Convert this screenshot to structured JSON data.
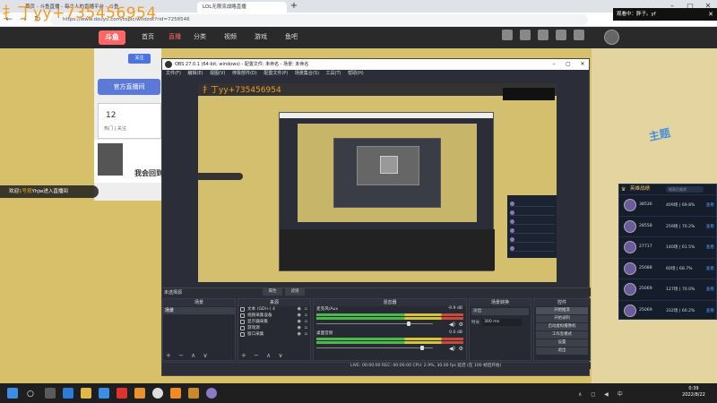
{
  "browser": {
    "tab1_title": "首页 - 斗鱼直播 - 每个人的直播平台 - 斗鱼",
    "tab2_title": "LOL无限流战略直播",
    "url": "https://www.douyu.com/topic/wndzdt?rid=7258546"
  },
  "watermark": "扌丁yy+735456954",
  "site": {
    "logo": "斗鱼",
    "nav": [
      "首页",
      "直播",
      "分类",
      "视频",
      "游戏",
      "鱼吧"
    ],
    "mini_button": "关注",
    "blue_button": "官方直播间",
    "card_num": "12",
    "card_label": "热门 | 关注",
    "streamer_name": "我会回到",
    "brand_logo": "主题"
  },
  "viewer_box": {
    "text": "观看中：胖子。yf",
    "close": "✕"
  },
  "chat_toast": {
    "prefix": "欢迎",
    "user": "1号观",
    "suffix": "Yhjw进入直播间"
  },
  "obs": {
    "title": "OBS 27.0.1 (64-bit, windows) - 配置文件: 未命名 - 场景: 未命名",
    "menus": [
      "文件(F)",
      "编辑(E)",
      "视图(V)",
      "停靠部件(D)",
      "配置文件(P)",
      "场景集合(S)",
      "工具(T)",
      "帮助(H)"
    ],
    "no_source": "未选择源",
    "properties_btn": "属性",
    "filters_btn": "滤镜",
    "docks": {
      "scenes_title": "场景",
      "sources_title": "来源",
      "mixer_title": "混音器",
      "transitions_title": "场景转换",
      "controls_title": "控件"
    },
    "scene_item": "场景",
    "sources": [
      "文本 (GDI+) 4",
      "视频采集设备",
      "显示器采集",
      "游戏源",
      "窗口采集"
    ],
    "mixer_tracks": [
      {
        "name": "麦克风/Aux",
        "db": "-9.9 dB",
        "level": 0.8
      },
      {
        "name": "桌面音频",
        "db": "0.0 dB",
        "level": 0.92
      }
    ],
    "transition_select": "淡出",
    "duration_label": "时长",
    "duration_value": "300 ms",
    "controls": [
      "开始推流",
      "开始录制",
      "启动虚拟摄像机",
      "工作室模式",
      "设置",
      "退出"
    ],
    "status": "LIVE: 00:00:00   REC: 00:00:00   CPU: 2.9%, 30.00 fps   延迟 (在 100 帧后开始)",
    "dock_foot": "+ − ∧ ∨"
  },
  "scoreboard": {
    "title": "英雄战绩",
    "search_placeholder": "搜索召唤师",
    "rows": [
      {
        "rank": "38536",
        "stat": "409场 | 69.8%",
        "link": "查看"
      },
      {
        "rank": "28558",
        "stat": "259场 | 70.2%",
        "link": "查看"
      },
      {
        "rank": "27717",
        "stat": "140场 | 61.5%",
        "link": "查看"
      },
      {
        "rank": "25088",
        "stat": "60场 | 68.7%",
        "link": "查看"
      },
      {
        "rank": "25069",
        "stat": "127场 | 70.0%",
        "link": "查看"
      },
      {
        "rank": "25069",
        "stat": "332场 | 60.2%",
        "link": "查看"
      }
    ]
  },
  "taskbar": {
    "time": "0:39",
    "date": "2022/8/22",
    "tray": "∧ ◻ ◀ 中"
  }
}
